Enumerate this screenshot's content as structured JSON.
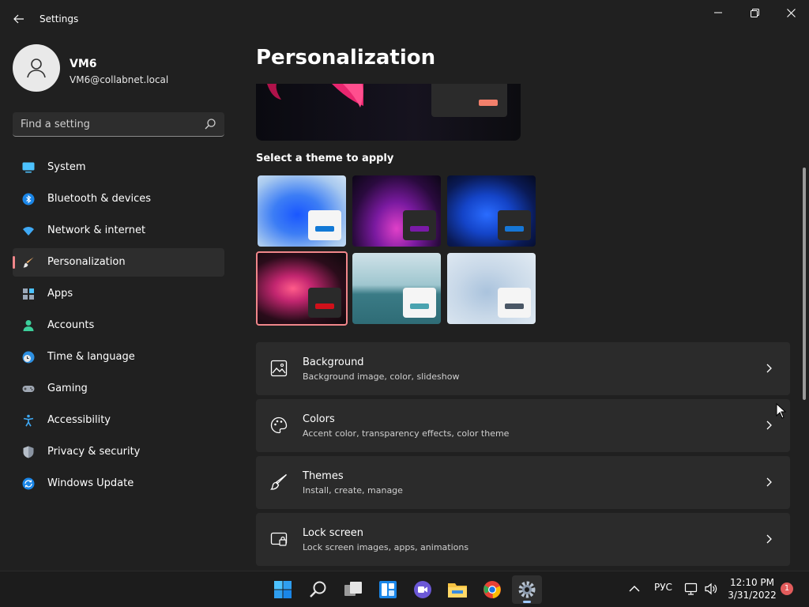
{
  "window": {
    "title": "Settings"
  },
  "profile": {
    "name": "VM6",
    "email": "VM6@collabnet.local"
  },
  "search": {
    "placeholder": "Find a setting"
  },
  "nav": {
    "items": [
      {
        "label": "System",
        "icon": "monitor-icon"
      },
      {
        "label": "Bluetooth & devices",
        "icon": "bluetooth-icon"
      },
      {
        "label": "Network & internet",
        "icon": "wifi-icon"
      },
      {
        "label": "Personalization",
        "icon": "brush-icon"
      },
      {
        "label": "Apps",
        "icon": "apps-icon"
      },
      {
        "label": "Accounts",
        "icon": "person-icon"
      },
      {
        "label": "Time & language",
        "icon": "clock-globe-icon"
      },
      {
        "label": "Gaming",
        "icon": "gamepad-icon"
      },
      {
        "label": "Accessibility",
        "icon": "accessibility-icon"
      },
      {
        "label": "Privacy & security",
        "icon": "shield-icon"
      },
      {
        "label": "Windows Update",
        "icon": "update-icon"
      }
    ],
    "active": "Personalization"
  },
  "main": {
    "title": "Personalization",
    "themes_label": "Select a theme to apply",
    "theme_accents": [
      "#1279d6",
      "#7a1aa8",
      "#1676d6",
      "#d0101a",
      "#4aa3b0",
      "#4a5766"
    ],
    "selected_theme": 4,
    "cards": [
      {
        "title": "Background",
        "subtitle": "Background image, color, slideshow",
        "icon": "image-icon"
      },
      {
        "title": "Colors",
        "subtitle": "Accent color, transparency effects, color theme",
        "icon": "palette-icon"
      },
      {
        "title": "Themes",
        "subtitle": "Install, create, manage",
        "icon": "brush-icon"
      },
      {
        "title": "Lock screen",
        "subtitle": "Lock screen images, apps, animations",
        "icon": "lock-screen-icon"
      }
    ]
  },
  "taskbar": {
    "apps": [
      "start-icon",
      "search-icon",
      "task-view-icon",
      "widgets-icon",
      "chat-icon",
      "file-explorer-icon",
      "chrome-icon",
      "settings-gear-icon"
    ],
    "language": "РУС",
    "time": "12:10 PM",
    "date": "3/31/2022",
    "notifications": "1"
  },
  "colors": {
    "accent": "#f0868a",
    "background": "#202020",
    "card": "#2b2b2b"
  }
}
